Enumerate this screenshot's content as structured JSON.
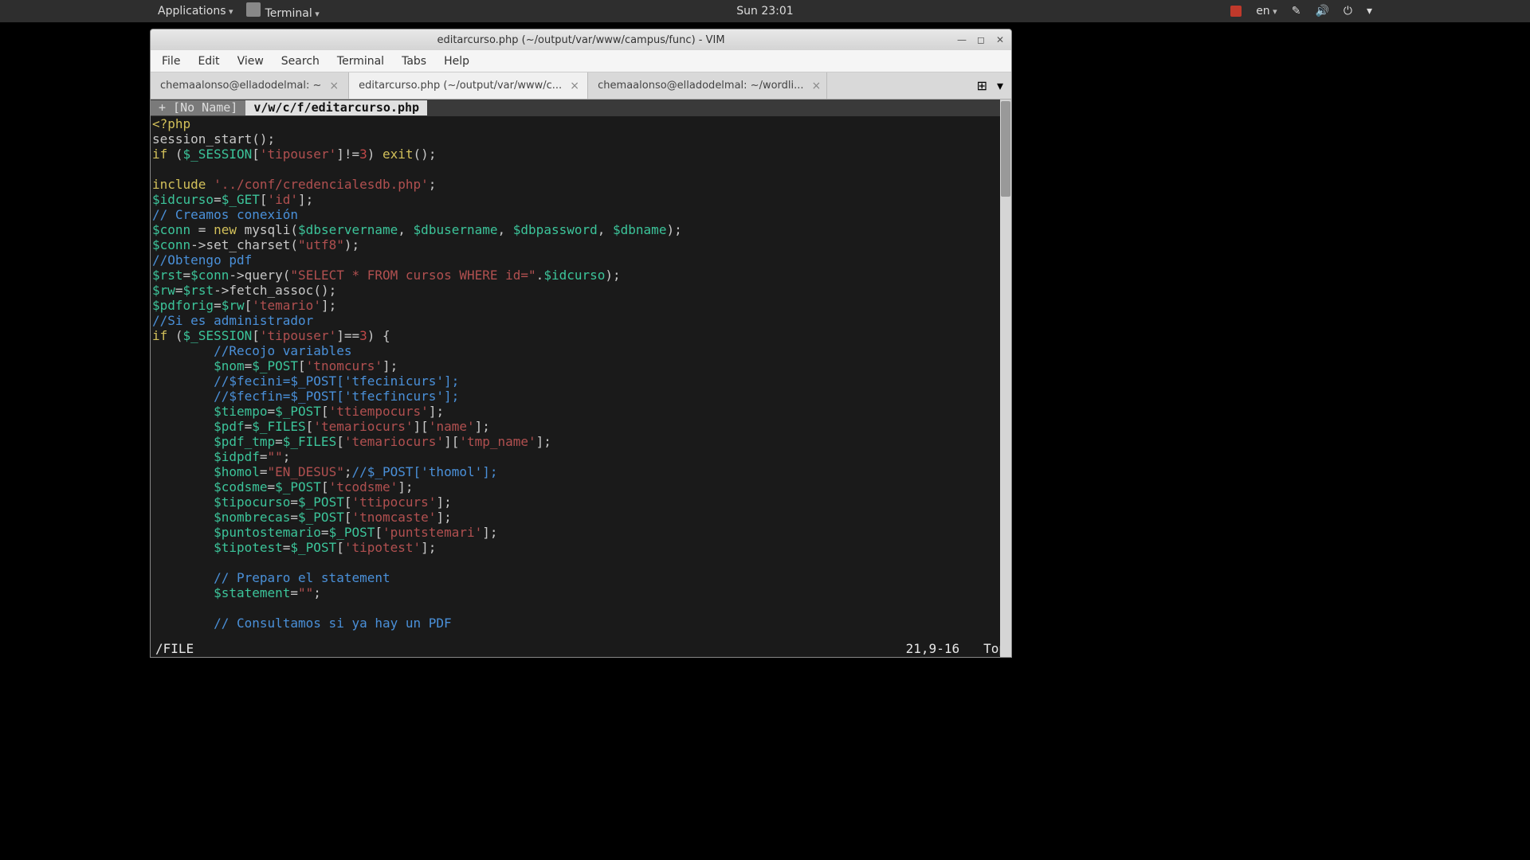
{
  "topbar": {
    "applications": "Applications",
    "terminal": "Terminal",
    "clock": "Sun 23:01",
    "lang": "en"
  },
  "window": {
    "title": "editarcurso.php (~/output/var/www/campus/func) - VIM",
    "minimize": "—",
    "maximize": "◻",
    "close": "✕"
  },
  "menubar": {
    "file": "File",
    "edit": "Edit",
    "view": "View",
    "search": "Search",
    "terminal": "Terminal",
    "tabs": "Tabs",
    "help": "Help"
  },
  "tabs": {
    "t1": "chemaalonso@elladodelmal: ~",
    "t2": "editarcurso.php (~/output/var/www/c...",
    "t3": "chemaalonso@elladodelmal: ~/wordli...",
    "close": "×",
    "newtab": "▾"
  },
  "vim": {
    "tab1": "+  [No Name]",
    "tab2": "v/w/c/f/editarcurso.php",
    "status_cmd": "/FILE",
    "status_pos": "21,9-16",
    "status_pct": "Top"
  },
  "code": {
    "l1a": "<?php",
    "l2a": "session_start",
    "l2b": "();",
    "l3a": "if",
    "l3b": " (",
    "l3c": "$_SESSION",
    "l3d": "[",
    "l3e": "'tipouser'",
    "l3f": "]!=",
    "l3g": "3",
    "l3h": ") ",
    "l3i": "exit",
    "l3j": "();",
    "l5a": "include",
    "l5b": " ",
    "l5c": "'../conf/credencialesdb.php'",
    "l5d": ";",
    "l6a": "$idcurso",
    "l6b": "=",
    "l6c": "$_GET",
    "l6d": "[",
    "l6e": "'id'",
    "l6f": "];",
    "l7a": "// Creamos conexión",
    "l8a": "$conn",
    "l8b": " = ",
    "l8c": "new",
    "l8d": " mysqli(",
    "l8e": "$dbservername",
    "l8f": ", ",
    "l8g": "$dbusername",
    "l8h": ", ",
    "l8i": "$dbpassword",
    "l8j": ", ",
    "l8k": "$dbname",
    "l8l": ");",
    "l9a": "$conn",
    "l9b": "->",
    "l9c": "set_charset",
    "l9d": "(",
    "l9e": "\"utf8\"",
    "l9f": ");",
    "l10a": "//Obtengo pdf",
    "l11a": "$rst",
    "l11b": "=",
    "l11c": "$conn",
    "l11d": "->",
    "l11e": "query",
    "l11f": "(",
    "l11g": "\"SELECT * FROM cursos WHERE id=\"",
    "l11h": ".",
    "l11i": "$idcurso",
    "l11j": ");",
    "l12a": "$rw",
    "l12b": "=",
    "l12c": "$rst",
    "l12d": "->",
    "l12e": "fetch_assoc",
    "l12f": "();",
    "l13a": "$pdforig",
    "l13b": "=",
    "l13c": "$rw",
    "l13d": "[",
    "l13e": "'temario'",
    "l13f": "];",
    "l14a": "//Si es administrador",
    "l15a": "if",
    "l15b": " (",
    "l15c": "$_SESSION",
    "l15d": "[",
    "l15e": "'tipouser'",
    "l15f": "]==",
    "l15g": "3",
    "l15h": ") {",
    "l16a": "        ",
    "l16b": "//Recojo variables",
    "l17a": "        ",
    "l17b": "$nom",
    "l17c": "=",
    "l17d": "$_POST",
    "l17e": "[",
    "l17f": "'tnomcurs'",
    "l17g": "];",
    "l18a": "        ",
    "l18b": "//$fecini=$_POST['tfecinicurs'];",
    "l19a": "        ",
    "l19b": "//$fecfin=$_POST['tfecfincurs'];",
    "l20a": "        ",
    "l20b": "$tiempo",
    "l20c": "=",
    "l20d": "$_POST",
    "l20e": "[",
    "l20f": "'ttiempocurs'",
    "l20g": "];",
    "l21a": "        ",
    "l21b": "$pdf",
    "l21c": "=",
    "l21d": "$_FILES",
    "l21e": "[",
    "l21f": "'temariocurs'",
    "l21g": "][",
    "l21h": "'name'",
    "l21i": "];",
    "l22a": "        ",
    "l22b": "$pdf_tmp",
    "l22c": "=",
    "l22d": "$_FILES",
    "l22e": "[",
    "l22f": "'temariocurs'",
    "l22g": "][",
    "l22h": "'tmp_name'",
    "l22i": "];",
    "l23a": "        ",
    "l23b": "$idpdf",
    "l23c": "=",
    "l23d": "\"\"",
    "l23e": ";",
    "l24a": "        ",
    "l24b": "$homol",
    "l24c": "=",
    "l24d": "\"EN_DESUS\"",
    "l24e": ";",
    "l24f": "//$_POST['thomol'];",
    "l25a": "        ",
    "l25b": "$codsme",
    "l25c": "=",
    "l25d": "$_POST",
    "l25e": "[",
    "l25f": "'tcodsme'",
    "l25g": "];",
    "l26a": "        ",
    "l26b": "$tipocurso",
    "l26c": "=",
    "l26d": "$_POST",
    "l26e": "[",
    "l26f": "'ttipocurs'",
    "l26g": "];",
    "l27a": "        ",
    "l27b": "$nombrecas",
    "l27c": "=",
    "l27d": "$_POST",
    "l27e": "[",
    "l27f": "'tnomcaste'",
    "l27g": "];",
    "l28a": "        ",
    "l28b": "$puntostemario",
    "l28c": "=",
    "l28d": "$_POST",
    "l28e": "[",
    "l28f": "'puntstemari'",
    "l28g": "];",
    "l29a": "        ",
    "l29b": "$tipotest",
    "l29c": "=",
    "l29d": "$_POST",
    "l29e": "[",
    "l29f": "'tipotest'",
    "l29g": "];",
    "l31a": "        ",
    "l31b": "// Preparo el statement",
    "l32a": "        ",
    "l32b": "$statement",
    "l32c": "=",
    "l32d": "\"\"",
    "l32e": ";",
    "l34a": "        ",
    "l34b": "// Consultamos si ya hay un PDF"
  }
}
